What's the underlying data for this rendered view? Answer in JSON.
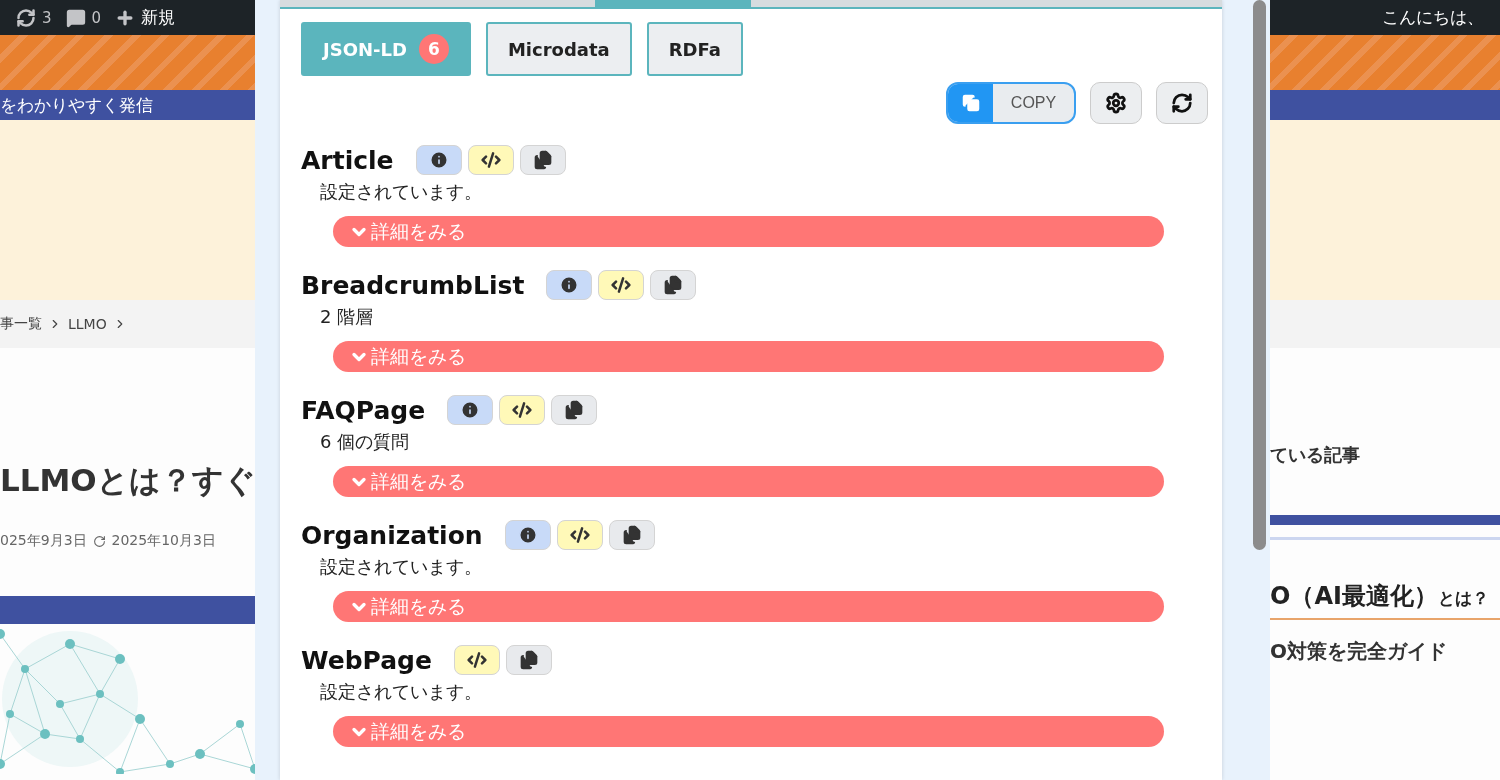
{
  "background_page": {
    "admin_bar": {
      "items": [
        {
          "kind": "updates",
          "label": "3"
        },
        {
          "kind": "comments",
          "label": "0"
        },
        {
          "kind": "new",
          "label": "新規"
        }
      ],
      "greeting": "こんにちは、"
    },
    "tagline": "をわかりやすく発信",
    "breadcrumb": [
      {
        "label": "事一覧"
      },
      {
        "label": "LLMO"
      }
    ],
    "title": "LLMOとは？すぐ",
    "published": "025年9月3日",
    "updated": "2025年10月3日",
    "sidebar": {
      "heading": "ている記事",
      "article_title": "O（AI最適化）",
      "article_title_suffix": "とは？",
      "article_subtitle": "O対策を完全ガイド"
    }
  },
  "extension": {
    "format_tabs": [
      {
        "label": "JSON-LD",
        "selected": true,
        "count": "6"
      },
      {
        "label": "Microdata",
        "selected": false
      },
      {
        "label": "RDFa",
        "selected": false
      }
    ],
    "copy_toggle": {
      "label": "COPY",
      "on": true
    },
    "schemas": [
      {
        "name": "Article",
        "summary": "設定されています。",
        "buttons": [
          {
            "kind": "info"
          },
          {
            "kind": "code"
          },
          {
            "kind": "copy"
          }
        ],
        "details_label": "詳細をみる"
      },
      {
        "name": "BreadcrumbList",
        "summary": "2 階層",
        "buttons": [
          {
            "kind": "info"
          },
          {
            "kind": "code"
          },
          {
            "kind": "copy"
          }
        ],
        "details_label": "詳細をみる"
      },
      {
        "name": "FAQPage",
        "summary": "6 個の質問",
        "buttons": [
          {
            "kind": "info"
          },
          {
            "kind": "code"
          },
          {
            "kind": "copy"
          }
        ],
        "details_label": "詳細をみる"
      },
      {
        "name": "Organization",
        "summary": "設定されています。",
        "buttons": [
          {
            "kind": "info"
          },
          {
            "kind": "code"
          },
          {
            "kind": "copy"
          }
        ],
        "details_label": "詳細をみる"
      },
      {
        "name": "WebPage",
        "summary": "設定されています。",
        "buttons": [
          {
            "kind": "code"
          },
          {
            "kind": "copy"
          }
        ],
        "details_label": "詳細をみる"
      }
    ]
  }
}
